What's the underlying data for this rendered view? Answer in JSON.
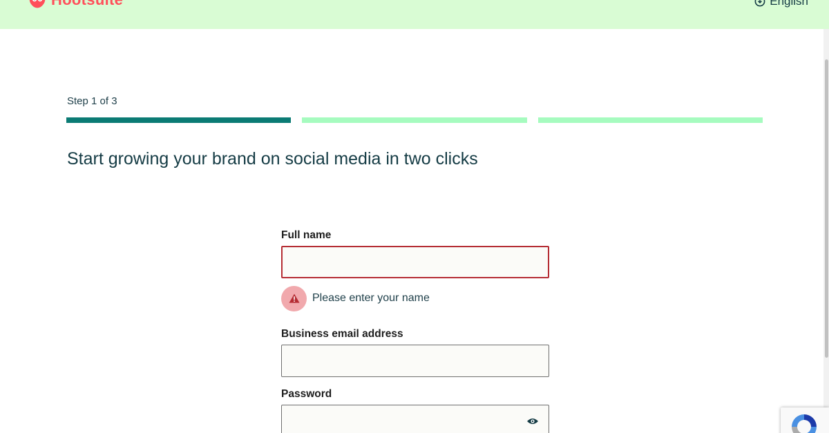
{
  "header": {
    "logo_text": "Hootsuite",
    "language_label": "English",
    "colors": {
      "background": "#d9fcd4",
      "logo": "#ff4f5a"
    }
  },
  "progress": {
    "step_label": "Step 1 of 3",
    "current_step": 1,
    "total_steps": 3,
    "colors": {
      "active": "#0b7b74",
      "inactive": "#a6fbbf"
    }
  },
  "headline": "Start growing your brand on social media in two clicks",
  "form": {
    "full_name": {
      "label": "Full name",
      "value": "",
      "error": "Please enter your name"
    },
    "email": {
      "label": "Business email address",
      "value": ""
    },
    "password": {
      "label": "Password",
      "value": ""
    }
  },
  "icons": {
    "language": "globe-icon",
    "error": "warning-icon",
    "password_toggle": "eye-icon",
    "captcha": "recaptcha-icon"
  }
}
